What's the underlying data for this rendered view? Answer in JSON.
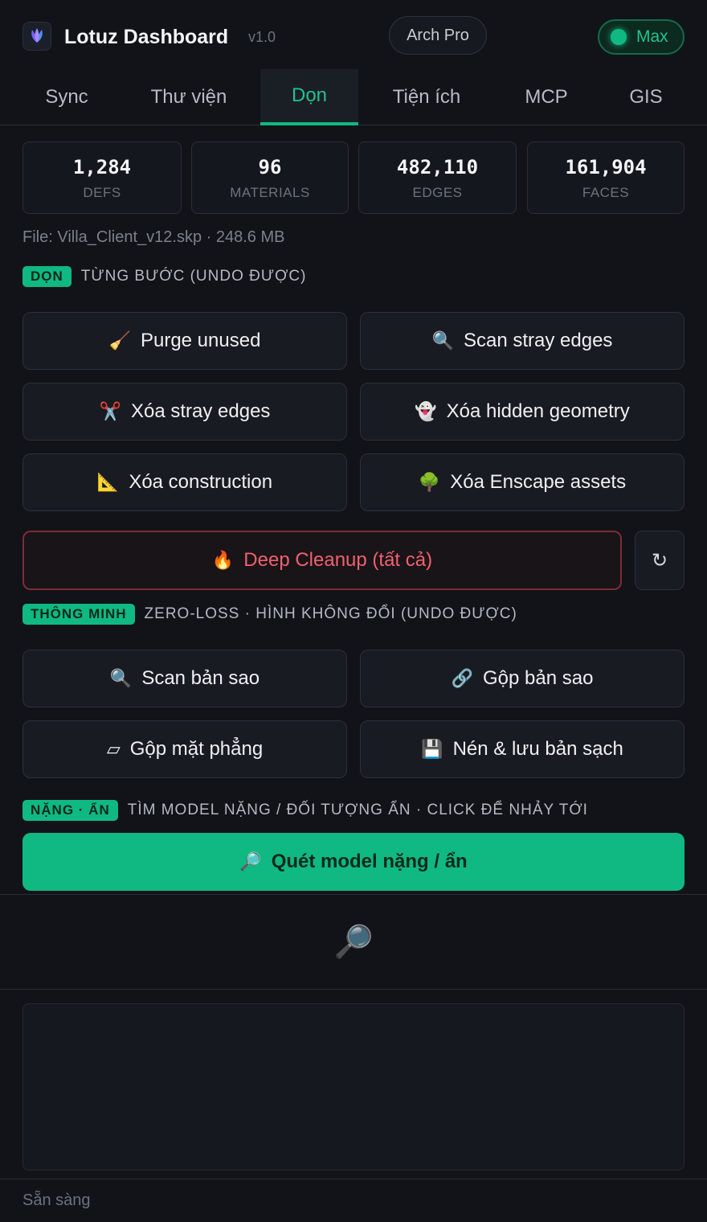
{
  "app": {
    "title": "Lotuz Dashboard",
    "version": "v1.0",
    "plan": "Arch Pro",
    "tier": "Max"
  },
  "tabs": [
    "Sync",
    "Thư viện",
    "Dọn",
    "Tiện ích",
    "MCP",
    "GIS"
  ],
  "active_tab": "Dọn",
  "stats": [
    {
      "value": "1,284",
      "label": "DEFS"
    },
    {
      "value": "96",
      "label": "MATERIALS"
    },
    {
      "value": "482,110",
      "label": "EDGES"
    },
    {
      "value": "161,904",
      "label": "FACES"
    }
  ],
  "file_info": "File: Villa_Client_v12.skp · 248.6 MB",
  "sections": {
    "don": {
      "badge": "DỌN",
      "desc": "TỪNG BƯỚC (UNDO ĐƯỢC)"
    },
    "smart": {
      "badge": "THÔNG MINH",
      "desc": "ZERO-LOSS · HÌNH KHÔNG ĐỔI (UNDO ĐƯỢC)"
    },
    "heavy": {
      "badge": "NẶNG · ẨN",
      "desc": "TÌM MODEL NẶNG / ĐỐI TƯỢNG ẨN · CLICK ĐỂ NHẢY TỚI"
    }
  },
  "buttons": {
    "purge": {
      "label": "Purge unused",
      "icon": "🧹"
    },
    "scan_stray": {
      "label": "Scan stray edges",
      "icon": "🔍"
    },
    "del_stray": {
      "label": "Xóa stray edges",
      "icon": "✂️"
    },
    "del_hidden": {
      "label": "Xóa hidden geometry",
      "icon": "👻"
    },
    "del_construction": {
      "label": "Xóa construction",
      "icon": "📐"
    },
    "del_enscape": {
      "label": "Xóa Enscape assets",
      "icon": "🌳"
    },
    "deep_cleanup": {
      "label": "Deep Cleanup (tất cả)",
      "icon": "🔥"
    },
    "refresh": {
      "icon": "↻"
    },
    "scan_dup": {
      "label": "Scan bản sao",
      "icon": "🔍"
    },
    "merge_dup": {
      "label": "Gộp bản sao",
      "icon": "🔗"
    },
    "merge_planes": {
      "label": "Gộp mặt phẳng",
      "icon": "▱"
    },
    "compress_save": {
      "label": "Nén & lưu bản sạch",
      "icon": "💾"
    },
    "scan_heavy": {
      "label": "Quét model nặng / ẩn",
      "icon": "🔎"
    }
  },
  "empty_icon": "🔎",
  "status": "Sẵn sàng",
  "colors": {
    "accent": "#10b981",
    "danger": "#f0616d",
    "background": "#111318"
  }
}
